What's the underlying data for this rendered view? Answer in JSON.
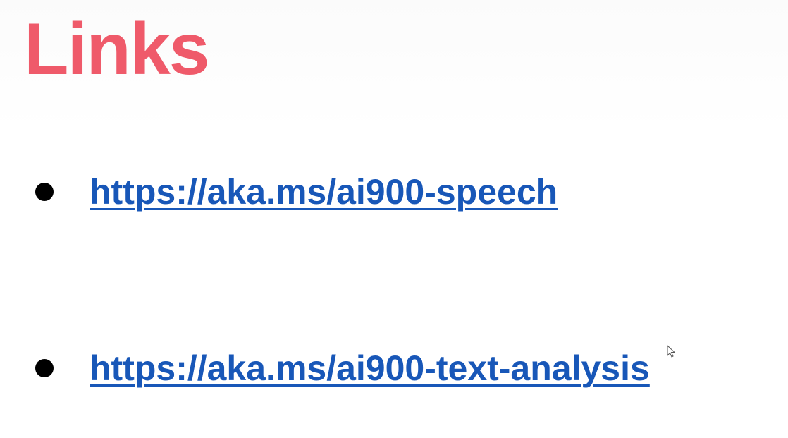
{
  "slide": {
    "title": "Links",
    "links": [
      {
        "text": "https://aka.ms/ai900-speech"
      },
      {
        "text": "https://aka.ms/ai900-text-analysis"
      }
    ]
  },
  "colors": {
    "title": "#ef5a6a",
    "link": "#1857b8",
    "bullet": "#000000",
    "background": "#ffffff"
  }
}
